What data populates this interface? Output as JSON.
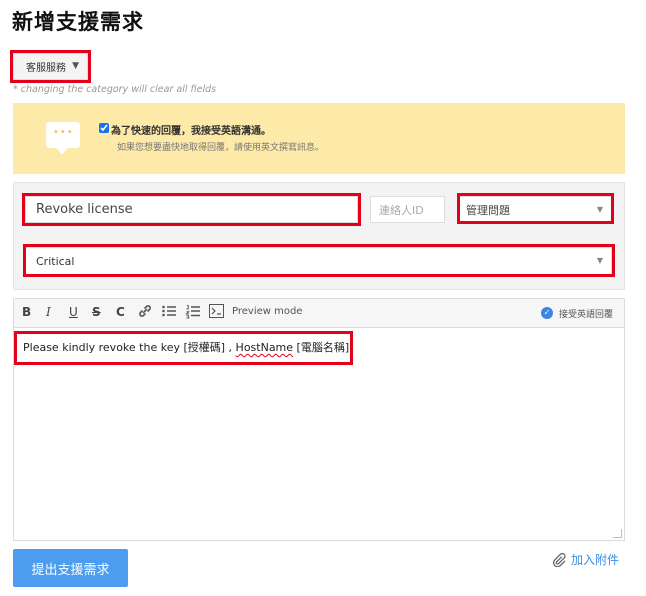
{
  "page": {
    "title": "新增支援需求"
  },
  "category": {
    "value": "客服服務",
    "note": "* changing the category will clear all fields"
  },
  "notice": {
    "icon": "chat-bubble-icon",
    "checked": true,
    "text": "為了快速的回覆，我接受英語溝通。",
    "subtext": "如果您想要盡快地取得回覆，請使用英文撰寫訊息。"
  },
  "form": {
    "subject_value": "Revoke license",
    "contact_id_placeholder": "連絡人ID",
    "problem_value": "管理問題",
    "priority_value": "Critical"
  },
  "toolbar": {
    "bold": "B",
    "italic": "I",
    "underline": "U",
    "strike": "S",
    "code": "C",
    "preview_label": "Preview mode",
    "accept_en_label": "接受英語回覆"
  },
  "editor": {
    "text_a": "Please kindly revoke the key [授權碼] , ",
    "text_b": "HostName",
    "text_c": " [電腦名稱]"
  },
  "actions": {
    "submit_label": "提出支援需求",
    "attach_label": "加入附件"
  },
  "colors": {
    "accent": "#4c9cf0",
    "highlight": "#e3001b",
    "notice_bg": "#fde9a8"
  }
}
